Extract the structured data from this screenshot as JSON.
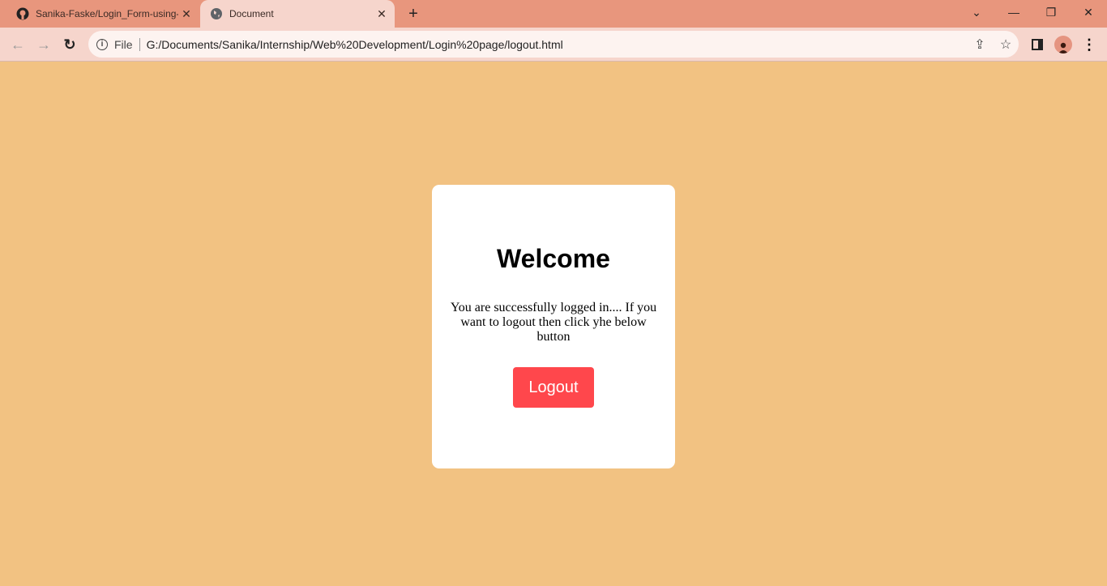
{
  "browser": {
    "tabs": [
      {
        "title": "Sanika-Faske/Login_Form-using-",
        "icon": "github-icon"
      },
      {
        "title": "Document",
        "icon": "globe-icon"
      }
    ],
    "address": {
      "scheme_label": "File",
      "url": "G:/Documents/Sanika/Internship/Web%20Development/Login%20page/logout.html"
    }
  },
  "page": {
    "heading": "Welcome",
    "message": "You are successfully logged in.... If you want to logout then click yhe below button",
    "logout_label": "Logout"
  },
  "colors": {
    "background": "#f2c282",
    "button": "#ff474c",
    "tabbar": "#e8967d"
  }
}
